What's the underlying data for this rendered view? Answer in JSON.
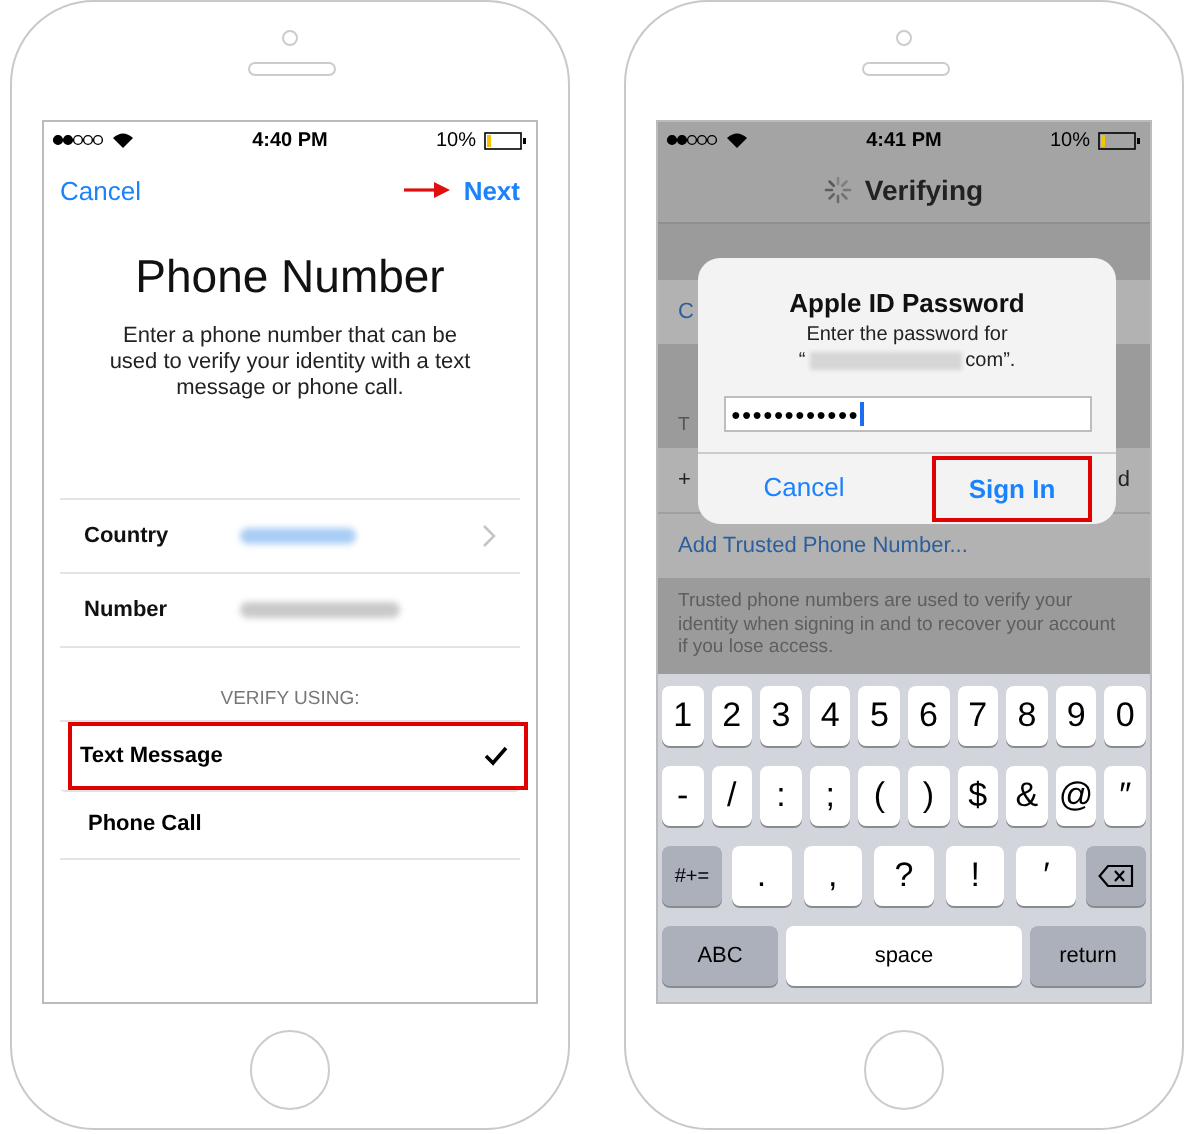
{
  "phones": [
    {
      "kind": "setup",
      "status": {
        "time": "4:40 PM",
        "battery": "10%"
      },
      "nav": {
        "cancel": "Cancel",
        "next": "Next",
        "next_pointer": true
      },
      "title": "Phone Number",
      "description": "Enter a phone number that can be used to verify your identity with a text message or phone call.",
      "fields": [
        {
          "label": "Country",
          "chevron": true
        },
        {
          "label": "Number",
          "chevron": false
        }
      ],
      "section_header": "VERIFY USING:",
      "options": [
        {
          "label": "Text Message",
          "selected": true,
          "outlined": true
        },
        {
          "label": "Phone Call",
          "selected": false,
          "outlined": false
        }
      ]
    },
    {
      "kind": "password",
      "status": {
        "time": "4:41 PM",
        "battery": "10%"
      },
      "title": "Verifying",
      "background": {
        "row_text": "C",
        "header_text": "T",
        "number_prefix": "+",
        "number_suffix": "d",
        "add_link": "Add Trusted Phone Number...",
        "footer": "Trusted phone numbers are used to verify your identity when signing in and to recover your account if you lose access."
      },
      "dialog": {
        "title": "Apple ID Password",
        "message": "Enter the password for",
        "email_open": "“",
        "email_end": "com”.",
        "password": "●●●●●●●●●●●●",
        "buttons": [
          {
            "label": "Cancel",
            "outlined": false
          },
          {
            "label": "Sign In",
            "outlined": true
          }
        ]
      },
      "keyboard": [
        [
          {
            "kind": "char",
            "label": "1"
          },
          {
            "kind": "char",
            "label": "2"
          },
          {
            "kind": "char",
            "label": "3"
          },
          {
            "kind": "char",
            "label": "4"
          },
          {
            "kind": "char",
            "label": "5"
          },
          {
            "kind": "char",
            "label": "6"
          },
          {
            "kind": "char",
            "label": "7"
          },
          {
            "kind": "char",
            "label": "8"
          },
          {
            "kind": "char",
            "label": "9"
          },
          {
            "kind": "char",
            "label": "0"
          }
        ],
        [
          {
            "kind": "char",
            "label": "-"
          },
          {
            "kind": "char",
            "label": "/"
          },
          {
            "kind": "char",
            "label": ":"
          },
          {
            "kind": "char",
            "label": ";"
          },
          {
            "kind": "char",
            "label": "("
          },
          {
            "kind": "char",
            "label": ")"
          },
          {
            "kind": "char",
            "label": "$"
          },
          {
            "kind": "char",
            "label": "&"
          },
          {
            "kind": "char",
            "label": "@"
          },
          {
            "kind": "char",
            "label": "″"
          }
        ],
        [
          {
            "kind": "mod",
            "label": "#+="
          },
          {
            "kind": "wide",
            "label": "."
          },
          {
            "kind": "wide",
            "label": ","
          },
          {
            "kind": "wide",
            "label": "?"
          },
          {
            "kind": "wide",
            "label": "!"
          },
          {
            "kind": "wide",
            "label": "′"
          },
          {
            "kind": "delete"
          }
        ],
        [
          {
            "kind": "mod",
            "label": "ABC"
          },
          {
            "kind": "space",
            "label": "space"
          },
          {
            "kind": "mod",
            "label": "return"
          }
        ]
      ]
    }
  ]
}
